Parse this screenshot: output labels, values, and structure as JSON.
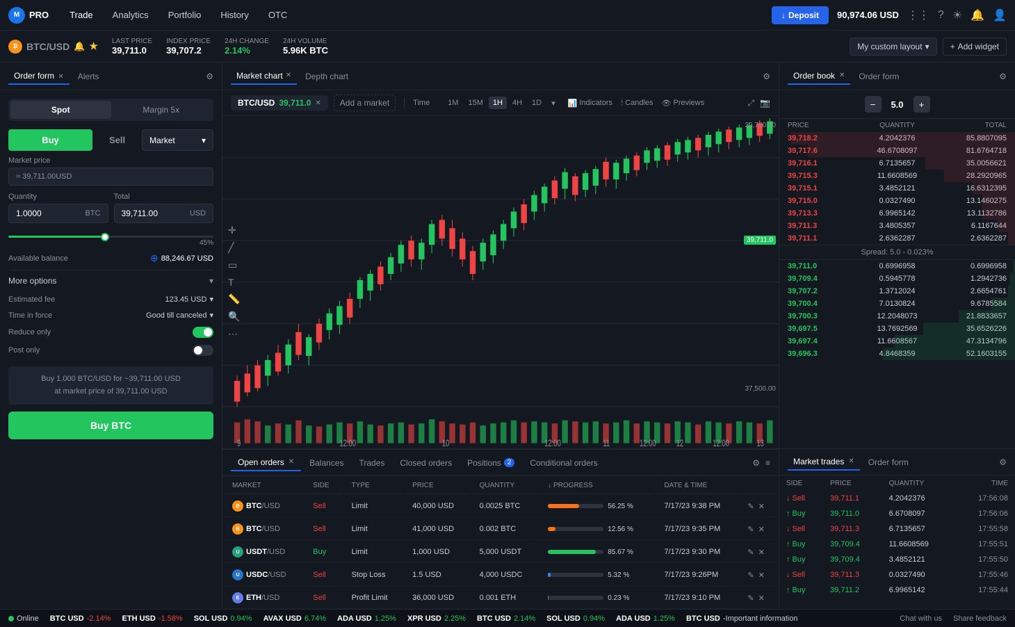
{
  "nav": {
    "logo": "PRO",
    "items": [
      "Trade",
      "Analytics",
      "Portfolio",
      "History",
      "OTC"
    ],
    "active": "Trade",
    "deposit_label": "Deposit",
    "balance": "90,974.06 USD"
  },
  "ticker": {
    "coin_symbol": "BTC",
    "pair": "BTC/USD",
    "bell": "🔔",
    "star": "★",
    "last_price_label": "LAST PRICE",
    "last_price": "39,711.0",
    "index_price_label": "INDEX PRICE",
    "index_price": "39,707.2",
    "change_label": "24H CHANGE",
    "change": "2.14%",
    "volume_label": "24H VOLUME",
    "volume": "5.96K BTC",
    "layout_label": "My custom layout",
    "add_widget_label": "Add widget"
  },
  "order_form": {
    "tabs": [
      {
        "label": "Order form",
        "active": true
      },
      {
        "label": "Alerts",
        "active": false
      }
    ],
    "spot_margin": [
      {
        "label": "Spot",
        "active": true
      },
      {
        "label": "Margin 5x",
        "active": false
      }
    ],
    "buy_label": "Buy",
    "sell_label": "Sell",
    "order_type": "Market",
    "market_price_label": "Market price",
    "market_price_approx": "≈ 39,711.00",
    "price_currency": "USD",
    "quantity_label": "Quantity",
    "quantity_value": "1.0000",
    "quantity_currency": "BTC",
    "total_label": "Total",
    "total_value": "39,711.00",
    "total_currency": "USD",
    "slider_percent": "45%",
    "available_balance_label": "Available balance",
    "available_balance": "88,246.67 USD",
    "more_options_label": "More options",
    "est_fee_label": "Estimated fee",
    "est_fee_value": "123.45 USD",
    "time_force_label": "Time in force",
    "time_force_value": "Good till canceled",
    "reduce_only_label": "Reduce only",
    "reduce_only_state": "on",
    "post_only_label": "Post only",
    "post_only_state": "off",
    "order_summary_line1": "Buy 1.000 BTC/USD for ~39,711.00 USD",
    "order_summary_line2": "at market price of 39,711.00 USD",
    "buy_btc_label": "Buy BTC"
  },
  "chart": {
    "tabs": [
      {
        "label": "Market chart",
        "active": true
      },
      {
        "label": "Depth chart",
        "active": false
      }
    ],
    "pair": "BTC/USD",
    "price": "39,711.0",
    "add_market_label": "Add a market",
    "time_label": "Time",
    "time_options": [
      "1M",
      "15M",
      "1H",
      "4H",
      "1D"
    ],
    "active_time": "1H",
    "indicators_label": "Indicators",
    "candles_label": "Candles",
    "previews_label": "Previews",
    "price_high": "39,750.00",
    "price_low": "37,500.00"
  },
  "order_book": {
    "tabs": [
      {
        "label": "Order book",
        "active": true
      },
      {
        "label": "Order form",
        "active": false
      }
    ],
    "depth_value": "5.0",
    "headers": [
      "PRICE",
      "QUANTITY",
      "TOTAL"
    ],
    "asks": [
      {
        "price": "39,718.2",
        "qty": "4.2042376",
        "total": "85.8807095",
        "pct": 95
      },
      {
        "price": "39,717.6",
        "qty": "46.6708097",
        "total": "81.6764718",
        "pct": 88
      },
      {
        "price": "39,716.1",
        "qty": "6.7135657",
        "total": "35.0056621",
        "pct": 38
      },
      {
        "price": "39,715.3",
        "qty": "11.6608569",
        "total": "28.2920965",
        "pct": 30
      },
      {
        "price": "39,715.1",
        "qty": "3.4852121",
        "total": "16.6312395",
        "pct": 18
      },
      {
        "price": "39,715.0",
        "qty": "0.0327490",
        "total": "13.1460275",
        "pct": 14
      },
      {
        "price": "39,713.3",
        "qty": "6.9965142",
        "total": "13.1132786",
        "pct": 14
      },
      {
        "price": "39,711.3",
        "qty": "3.4805357",
        "total": "6.1167644",
        "pct": 7
      },
      {
        "price": "39,711.1",
        "qty": "2.6362287",
        "total": "2.6362287",
        "pct": 3
      }
    ],
    "spread": "Spread: 5.0 - 0.023%",
    "bids": [
      {
        "price": "39,711.0",
        "qty": "0.6996958",
        "total": "0.6996958",
        "pct": 1
      },
      {
        "price": "39,709.4",
        "qty": "0.5945778",
        "total": "1.2942736",
        "pct": 2
      },
      {
        "price": "39,707.2",
        "qty": "1.3712024",
        "total": "2.6654761",
        "pct": 3
      },
      {
        "price": "39,700.4",
        "qty": "7.0130824",
        "total": "9.6785584",
        "pct": 10
      },
      {
        "price": "39,700.3",
        "qty": "12.2048073",
        "total": "21.8833657",
        "pct": 24
      },
      {
        "price": "39,697.5",
        "qty": "13.7692569",
        "total": "35.6526226",
        "pct": 39
      },
      {
        "price": "39,697.4",
        "qty": "11.6608567",
        "total": "47.3134796",
        "pct": 51
      },
      {
        "price": "39,696.3",
        "qty": "4.8468359",
        "total": "52.1603155",
        "pct": 56
      }
    ]
  },
  "open_orders": {
    "tabs": [
      {
        "label": "Open orders",
        "active": true,
        "badge": null
      },
      {
        "label": "Balances",
        "active": false
      },
      {
        "label": "Trades",
        "active": false
      },
      {
        "label": "Closed orders",
        "active": false
      },
      {
        "label": "Positions",
        "active": false,
        "badge": "2"
      },
      {
        "label": "Conditional orders",
        "active": false
      }
    ],
    "headers": [
      "MARKET",
      "SIDE",
      "TYPE",
      "PRICE",
      "QUANTITY",
      "PROGRESS",
      "DATE & TIME",
      ""
    ],
    "rows": [
      {
        "coin": "btc",
        "market": "BTC",
        "slash": "/USD",
        "side": "Sell",
        "side_color": "sell",
        "type": "Limit",
        "price": "40,000 USD",
        "qty": "0.0025 BTC",
        "progress_pct": "56.25 %",
        "progress_fill": 56,
        "progress_color": "orange",
        "date": "7/17/23 9:38 PM"
      },
      {
        "coin": "btc",
        "market": "BTC",
        "slash": "/USD",
        "side": "Sell",
        "side_color": "sell",
        "type": "Limit",
        "price": "41,000 USD",
        "qty": "0.002 BTC",
        "progress_pct": "12.56 %",
        "progress_fill": 13,
        "progress_color": "orange",
        "date": "7/17/23 9:35 PM"
      },
      {
        "coin": "usdt",
        "market": "USDT",
        "slash": "/USD",
        "side": "Buy",
        "side_color": "buy",
        "type": "Limit",
        "price": "1,000 USD",
        "qty": "5,000 USDT",
        "progress_pct": "85.67 %",
        "progress_fill": 86,
        "progress_color": "green",
        "date": "7/17/23 9:30 PM"
      },
      {
        "coin": "usdc",
        "market": "USDC",
        "slash": "/USD",
        "side": "Sell",
        "side_color": "sell",
        "type": "Stop Loss",
        "price": "1.5 USD",
        "qty": "4,000 USDC",
        "progress_pct": "5.32 %",
        "progress_fill": 5,
        "progress_color": "blue",
        "date": "7/17/23 9:26PM"
      },
      {
        "coin": "eth",
        "market": "ETH",
        "slash": "/USD",
        "side": "Sell",
        "side_color": "sell",
        "type": "Profit Limit",
        "price": "36,000 USD",
        "qty": "0.001 ETH",
        "progress_pct": "0.23 %",
        "progress_fill": 1,
        "progress_color": "gray",
        "date": "7/17/23 9:10 PM"
      }
    ]
  },
  "market_trades": {
    "tabs": [
      {
        "label": "Market trades",
        "active": true
      },
      {
        "label": "Order form",
        "active": false
      }
    ],
    "headers": [
      "SIDE",
      "PRICE",
      "QUANTITY",
      "TIME"
    ],
    "rows": [
      {
        "side": "Sell",
        "side_color": "sell",
        "price": "39,711.1",
        "qty": "4.2042376",
        "time": "17:56:08"
      },
      {
        "side": "Buy",
        "side_color": "buy",
        "price": "39,711.0",
        "qty": "6.6708097",
        "time": "17:56:06"
      },
      {
        "side": "Sell",
        "side_color": "sell",
        "price": "39,711.3",
        "qty": "6.7135657",
        "time": "17:55:58"
      },
      {
        "side": "Buy",
        "side_color": "buy",
        "price": "39,709.4",
        "qty": "11.6608569",
        "time": "17:55:51"
      },
      {
        "side": "Buy",
        "side_color": "buy",
        "price": "39,709.4",
        "qty": "3.4852121",
        "time": "17:55:50"
      },
      {
        "side": "Sell",
        "side_color": "sell",
        "price": "39,711.3",
        "qty": "0.0327490",
        "time": "17:55:46"
      },
      {
        "side": "Buy",
        "side_color": "buy",
        "price": "39,711.2",
        "qty": "6.9965142",
        "time": "17:55:44"
      }
    ]
  },
  "status_bar": {
    "status": "Online",
    "tickers": [
      {
        "sym": "BTC USD",
        "val": "-2.14%",
        "dir": "down"
      },
      {
        "sym": "ETH USD",
        "val": "-1.58%",
        "dir": "down"
      },
      {
        "sym": "SOL USD",
        "val": "0.94%",
        "dir": "up"
      },
      {
        "sym": "AVAX USD",
        "val": "6.74%",
        "dir": "up"
      },
      {
        "sym": "ADA USD",
        "val": "1.25%",
        "dir": "up"
      },
      {
        "sym": "XPR USD",
        "val": "2.25%",
        "dir": "up"
      },
      {
        "sym": "BTC USD",
        "val": "2.14%",
        "dir": "up"
      },
      {
        "sym": "SOL USD",
        "val": "0.94%",
        "dir": "up"
      },
      {
        "sym": "ADA USD",
        "val": "1.25%",
        "dir": "up"
      },
      {
        "sym": "BTC USD",
        "val": "-",
        "dir": "none"
      }
    ],
    "links": [
      "Important information",
      "Chat with us",
      "Share feedback"
    ]
  }
}
